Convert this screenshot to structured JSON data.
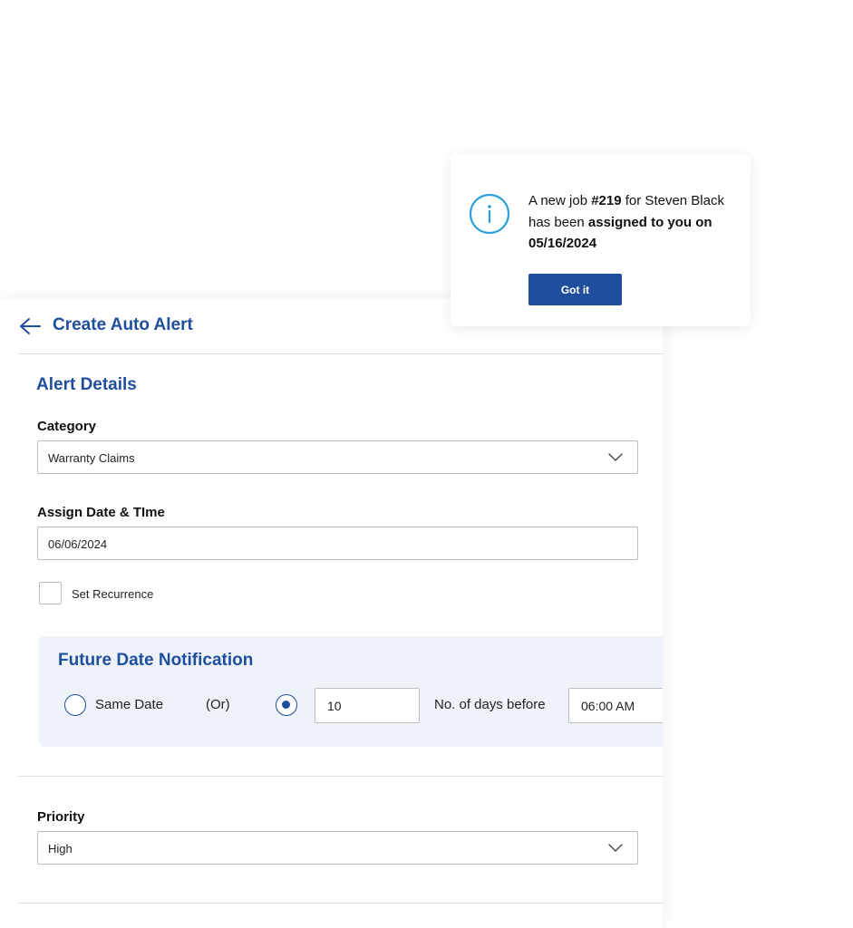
{
  "header": {
    "title": "Create Auto Alert"
  },
  "alert_details": {
    "section_title": "Alert Details",
    "category": {
      "label": "Category",
      "value": "Warranty Claims"
    },
    "assign_date": {
      "label": "Assign Date & TIme",
      "value": "06/06/2024"
    },
    "recurrence": {
      "label": "Set Recurrence",
      "checked": false
    }
  },
  "future_notification": {
    "title": "Future Date Notification",
    "same_date_label": "Same Date",
    "or_label": "(Or)",
    "days_value": "10",
    "days_label": "No. of days before",
    "time_value": "06:00 AM",
    "selected_option": "days_before"
  },
  "priority": {
    "label": "Priority",
    "value": "High"
  },
  "toast": {
    "text_1": "A new job ",
    "job_number": "#219",
    "text_2": " for Steven Black has been ",
    "bold_1": "assigned to you on 05/16/2024",
    "button_label": "Got it"
  },
  "icons": {
    "back": "arrow-left-icon",
    "dropdown": "chevron-down-icon",
    "info": "info-icon"
  },
  "colors": {
    "accent": "#1f4e9c",
    "info_icon": "#2a9fd8",
    "future_box_bg": "#eef3f9"
  }
}
